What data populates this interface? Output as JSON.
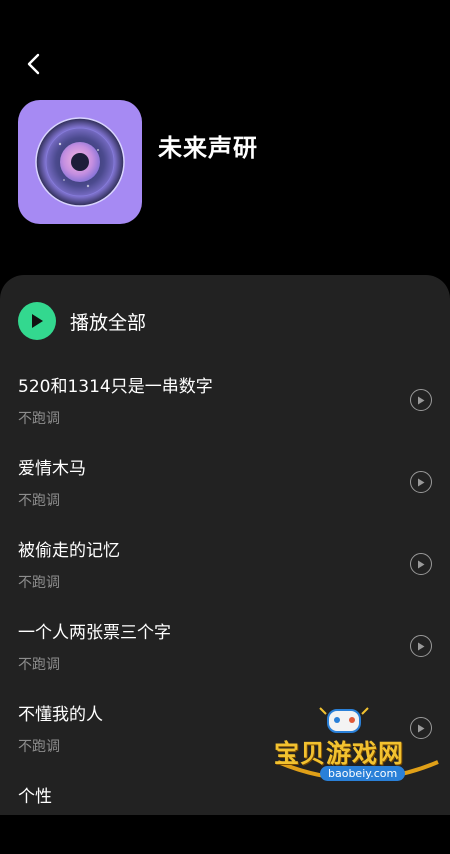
{
  "header": {
    "back_icon": "chevron-left-icon",
    "album_title": "未来声研"
  },
  "play_all": {
    "label": "播放全部",
    "icon": "play-circle-icon",
    "accent_color": "#33d88f"
  },
  "songs": [
    {
      "title": "520和1314只是一串数字",
      "artist": "不跑调"
    },
    {
      "title": "爱情木马",
      "artist": "不跑调"
    },
    {
      "title": "被偷走的记忆",
      "artist": "不跑调"
    },
    {
      "title": "一个人两张票三个字",
      "artist": "不跑调"
    },
    {
      "title": "不懂我的人",
      "artist": "不跑调"
    },
    {
      "title": "个性",
      "artist": ""
    }
  ],
  "watermark": {
    "text": "宝贝游戏网",
    "url": "baobeiy.com"
  }
}
